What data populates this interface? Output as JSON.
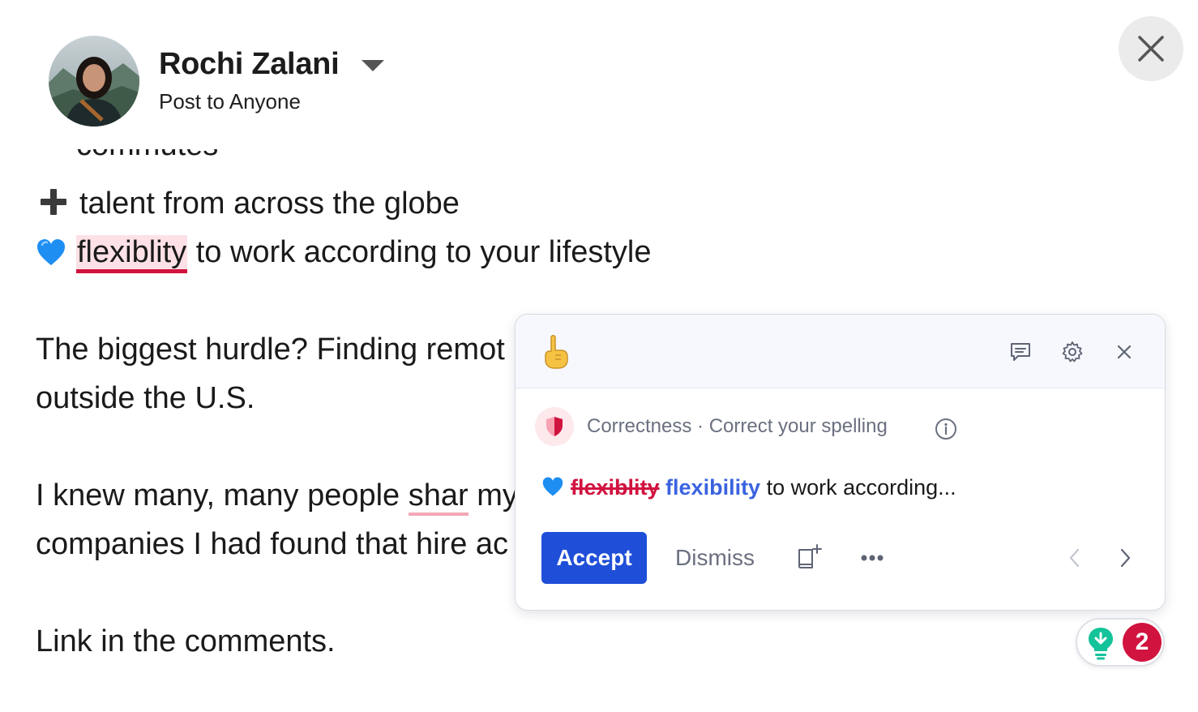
{
  "header": {
    "author_name": "Rochi Zalani",
    "audience": "Post to Anyone"
  },
  "post": {
    "cutoff_text": "commutes",
    "line_talent": "talent from across the globe",
    "line_flex_flagged": "flexiblity",
    "line_flex_rest": " to work according to your lifestyle",
    "para2_line1": "The biggest hurdle? Finding remot",
    "para2_line2": "outside the U.S.",
    "para3_line1_a": "I knew many, many people ",
    "para3_line1_flag": "shar",
    "para3_line1_b": " my",
    "para3_line2": "companies I had found that hire ac",
    "para4": "Link in the comments."
  },
  "card": {
    "category": "Correctness · Correct your spelling",
    "original_word": "flexiblity",
    "replacement_word": "flexibility",
    "context_rest": " to work according...",
    "accept_label": "Accept",
    "dismiss_label": "Dismiss"
  },
  "widget": {
    "suggestion_count": "2"
  },
  "colors": {
    "error_red": "#d1133f",
    "accept_blue": "#1f4fd8",
    "replacement_blue": "#3a63e0",
    "grammarly_green": "#15c39a"
  },
  "icons": [
    "chevron-down-icon",
    "close-icon",
    "plus-icon",
    "blue-heart-icon",
    "pointing-up-hand-icon",
    "feedback-icon",
    "gear-icon",
    "shield-icon",
    "info-icon",
    "add-to-dictionary-icon",
    "more-icon",
    "chevron-left-icon",
    "chevron-right-icon",
    "lightbulb-icon"
  ]
}
